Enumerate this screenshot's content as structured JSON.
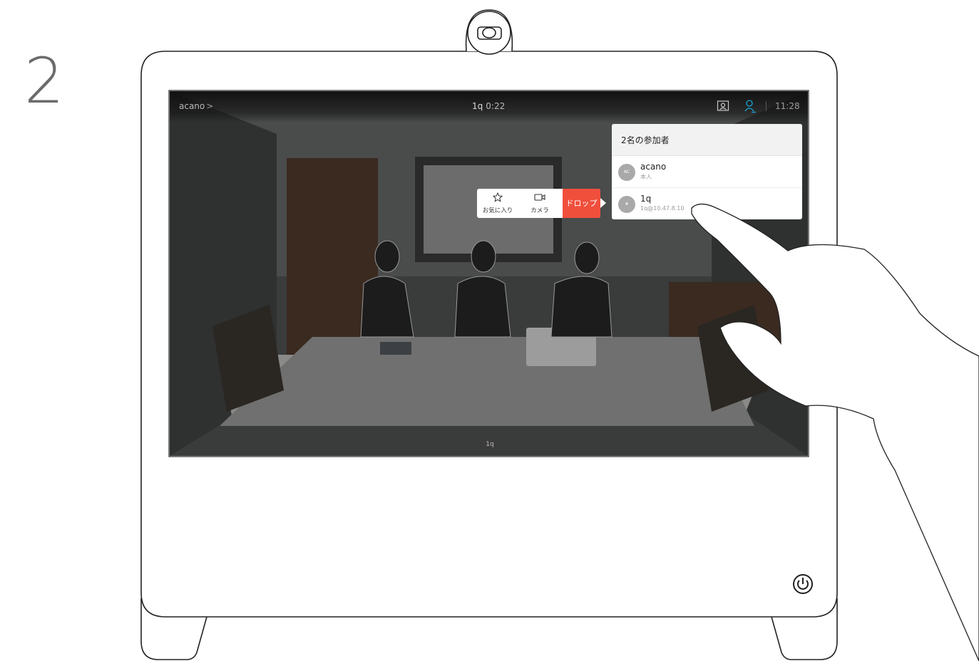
{
  "step": {
    "number": "2"
  },
  "call": {
    "caller_name": "acano",
    "caller_chevron": ">",
    "remote_name": "1q",
    "duration": "0:22",
    "clock": "11:28",
    "name_tag": "1q"
  },
  "participants_panel": {
    "title": "2名の参加者",
    "items": [
      {
        "avatar": "AC",
        "name": "acano",
        "sub": "本人"
      },
      {
        "avatar": "#",
        "name": "1q",
        "sub": "1q@10.47.8.10"
      }
    ]
  },
  "action_popup": {
    "favorite_label": "お気に入り",
    "camera_label": "カメラ",
    "drop_label": "ドロップ"
  },
  "colors": {
    "drop_button": "#f04f3c",
    "participants_icon_active": "#1aa6d8"
  },
  "icons": [
    "camera-lens-icon",
    "selfview-icon",
    "participants-icon",
    "star-icon",
    "video-camera-icon",
    "power-icon"
  ]
}
